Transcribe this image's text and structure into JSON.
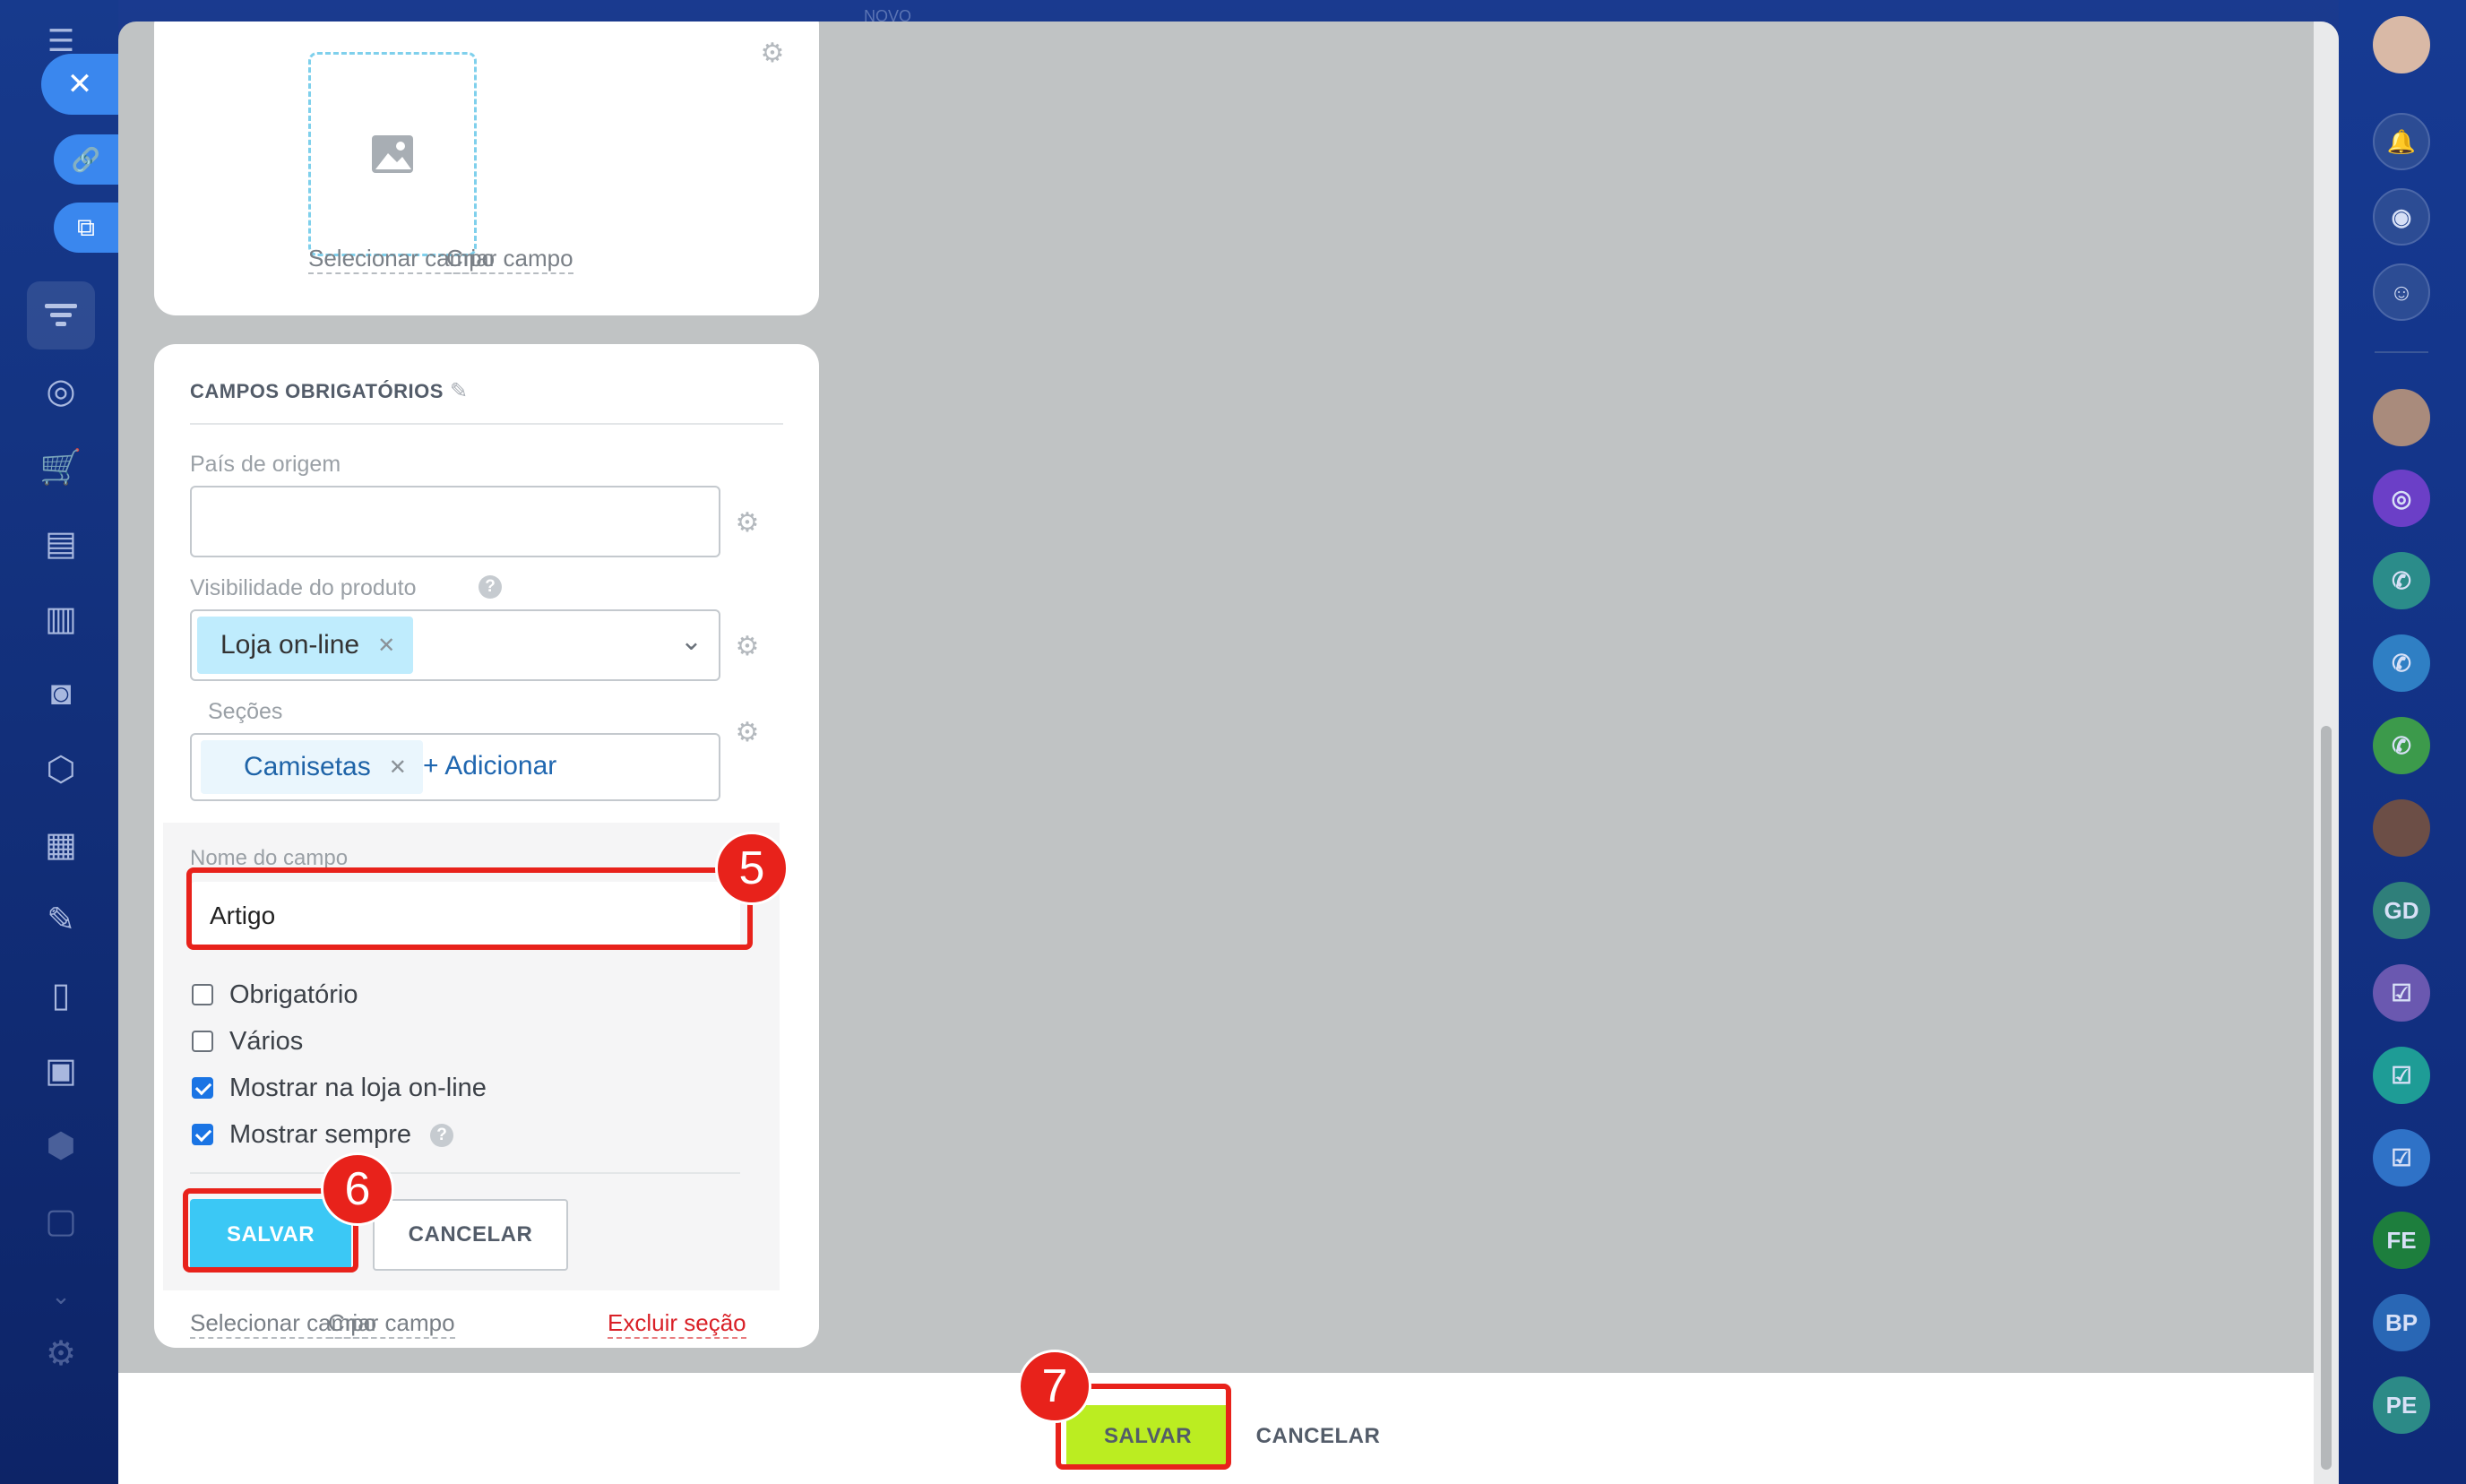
{
  "background": {
    "faded_tab": "NOVO"
  },
  "form": {
    "image_card": {
      "select_field": "Selecionar campo",
      "create_field": "Criar campo"
    },
    "required_section": {
      "title": "CAMPOS OBRIGATÓRIOS",
      "country_label": "País de origem",
      "country_value": "",
      "visibility_label": "Visibilidade do produto",
      "visibility_tag": "Loja on-line",
      "sections_label": "Seções",
      "sections_tag": "Camisetas",
      "add_link": "+ Adicionar",
      "field_name_label": "Nome do campo",
      "field_name_value": "Artigo",
      "checkboxes": [
        {
          "label": "Obrigatório",
          "checked": false
        },
        {
          "label": "Vários",
          "checked": false
        },
        {
          "label": "Mostrar na loja on-line",
          "checked": true
        },
        {
          "label": "Mostrar sempre",
          "checked": true
        }
      ],
      "save": "SALVAR",
      "cancel": "CANCELAR",
      "select_field": "Selecionar campo",
      "create_field": "Criar campo",
      "delete_section": "Excluir seção"
    }
  },
  "footer": {
    "save": "SALVAR",
    "cancel": "CANCELAR"
  },
  "annotations": {
    "step_5": "5",
    "step_6": "6",
    "step_7": "7"
  },
  "right_bar": {
    "avatars": [
      "GD",
      "FE",
      "BP",
      "PE"
    ]
  },
  "colors": {
    "accent_blue": "#3bc8f5",
    "save_green": "#bbed21",
    "annotation_red": "#e8221b",
    "link_blue": "#2067b0"
  }
}
